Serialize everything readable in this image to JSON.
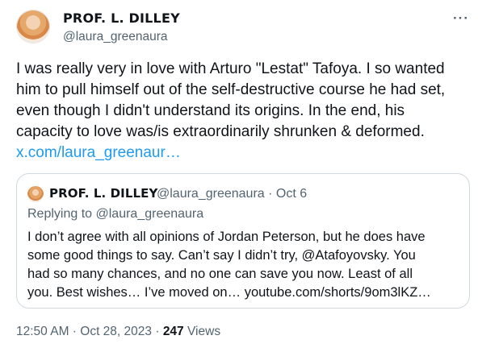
{
  "author": {
    "display_name": "PROF. L. DILLEY",
    "handle": "@laura_greenaura"
  },
  "menu": {
    "more_label": "···"
  },
  "tweet": {
    "lines": [
      "I was really very in love with Arturo \"Lestat\" Tafoya. I so wanted",
      "him to pull himself out of the self-destructive course he had set,",
      "even though I didn't understand its origins. In the end, his",
      "capacity to love was/is extraordinarily shrunken & deformed."
    ],
    "link": "x.com/laura_greenaur…"
  },
  "quoted": {
    "display_name": "PROF. L. DILLEY",
    "handle_date": "@laura_greenaura · Oct 6",
    "replying_to": "Replying to @laura_greenaura",
    "lines": [
      "I don’t agree with all opinions of Jordan Peterson, but he does have",
      "some good things to say. Can’t say I didn’t try, @Atafoyovsky. You",
      "had so many chances, and no one can save you now. Least of all",
      "you. Best wishes… I’ve moved on… youtube.com/shorts/9om3lKZ…"
    ]
  },
  "footer": {
    "timestamp": "12:50 AM · Oct 28, 2023 ·",
    "views_count": "247",
    "views_label": "Views"
  },
  "colors": {
    "text": "#0f1419",
    "secondary": "#536471",
    "link": "#1d9bf0",
    "border": "#cfd9de"
  }
}
